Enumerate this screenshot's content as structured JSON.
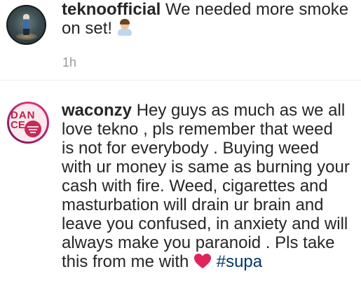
{
  "comments": [
    {
      "username": "teknoofficial",
      "text_line1": " We needed more smoke",
      "text_line2": "on set!",
      "emoji": "person-gesturing-emoji",
      "time": "1h"
    },
    {
      "username": "waconzy",
      "text_line1": " Hey guys as much as we all",
      "text_line2": "love tekno , pls remember that weed",
      "text_line3": "is not for everybody . Buying weed",
      "text_line4": "with ur money is same as burning your",
      "text_line5": "cash with fire. Weed, cigarettes and",
      "text_line6": "masturbation will drain ur brain and",
      "text_line7": "leave you confused, in anxiety and will",
      "text_line8": "always make you paranoid . Pls take",
      "text_line9": "this from me with ",
      "emoji": "red-heart-emoji",
      "hashtag": "#supa",
      "avatar_text_top": "DAN",
      "avatar_text_bottom": "CE"
    }
  ],
  "colors": {
    "text": "#262626",
    "timestamp": "#9a9a9a",
    "hashtag": "#00376b",
    "heart": "#e0245e"
  }
}
